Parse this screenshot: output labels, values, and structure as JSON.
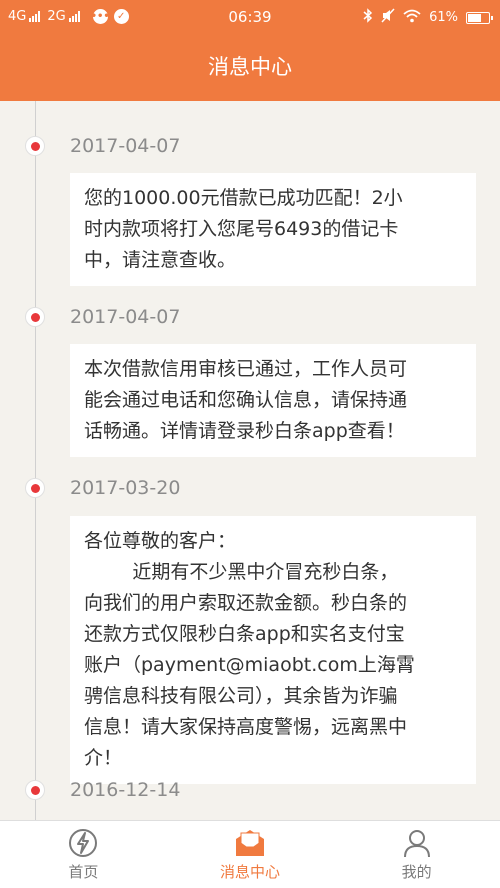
{
  "status_bar": {
    "network1": "4G",
    "network2": "2G",
    "time": "06:39",
    "battery": "61%",
    "battery_level": 0.61,
    "icons": [
      "signal-icon",
      "chat-icon",
      "check-icon",
      "bluetooth-icon",
      "mute-icon",
      "wifi-icon",
      "battery-icon"
    ]
  },
  "header": {
    "title": "消息中心"
  },
  "messages": [
    {
      "date": "2017-04-07",
      "lines": [
        "您的1000.00元借款已成功匹配！2小",
        "时内款项将打入您尾号6493的借记卡",
        "中，请注意查收。"
      ]
    },
    {
      "date": "2017-04-07",
      "lines": [
        "本次借款信用审核已通过，工作人员可",
        "能会通过电话和您确认信息，请保持通",
        "话畅通。详情请登录秒白条app查看！"
      ]
    },
    {
      "date": "2017-03-20",
      "lines": [
        "各位尊敬的客户：",
        "        近期有不少黑中介冒充秒白条，",
        "向我们的用户索取还款金额。秒白条的",
        "还款方式仅限秒白条app和实名支付宝",
        "账户（payment@miaobt.com上海霄",
        "骋信息科技有限公司），其余皆为诈骗",
        "信息！请大家保持高度警惕，远离黑中",
        "介！"
      ]
    },
    {
      "date": "2016-12-14",
      "lines": []
    }
  ],
  "tabs": [
    {
      "label": "首页",
      "icon": "lightning-icon",
      "active": false
    },
    {
      "label": "消息中心",
      "icon": "envelope-icon",
      "active": true
    },
    {
      "label": "我的",
      "icon": "user-icon",
      "active": false
    }
  ],
  "colors": {
    "accent": "#f07a3f",
    "dot": "#e8383b",
    "background": "#f4f2ed"
  }
}
